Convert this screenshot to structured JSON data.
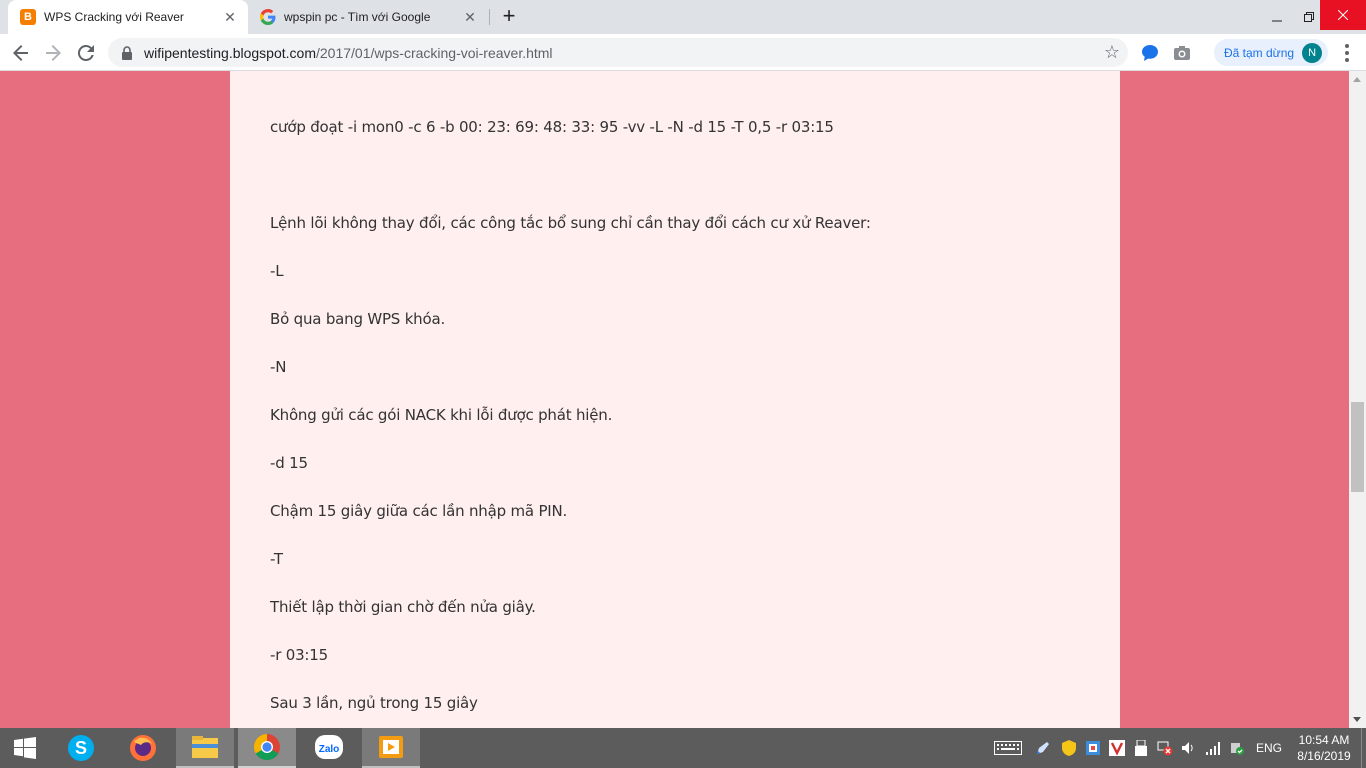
{
  "browser": {
    "tabs": [
      {
        "title": "WPS Cracking với Reaver",
        "favicon": "blogger-icon",
        "active": true
      },
      {
        "title": "wpspin pc - Tìm với Google",
        "favicon": "google-icon",
        "active": false
      }
    ],
    "url": {
      "host": "wifipentesting.blogspot.com",
      "path": "/2017/01/wps-cracking-voi-reaver.html"
    },
    "profile": {
      "paused_label": "Đã tạm dừng",
      "avatar_letter": "N"
    }
  },
  "article": {
    "lines": [
      "cướp đoạt -i mon0 -c 6 -b 00: 23: 69: 48: 33: 95 -vv -L -N -d 15 -T 0,5 -r 03:15",
      "Lệnh lõi không thay đổi, các công tắc bổ sung chỉ cần thay đổi cách cư xử Reaver:",
      "-L",
      "Bỏ qua bang WPS khóa.",
      "-N",
      "Không gửi các gói NACK khi lỗi được phát hiện.",
      "-d 15",
      "Chậm 15 giây giữa các lần nhập mã PIN.",
      "-T",
      "Thiết lập thời gian chờ đến nửa giây.",
      "-r 03:15",
      "Sau 3 lần, ngủ trong 15 giây"
    ]
  },
  "taskbar": {
    "apps": [
      "skype-icon",
      "firefox-icon",
      "file-explorer-icon",
      "chrome-icon",
      "zalo-icon",
      "media-player-icon"
    ],
    "zalo_label": "Zalo",
    "language": "ENG",
    "time": "10:54 AM",
    "date": "8/16/2019"
  },
  "colors": {
    "page_background": "#e76e7e",
    "post_background": "#ffefef",
    "text": "#333333",
    "taskbar": "#5c5c5c"
  }
}
